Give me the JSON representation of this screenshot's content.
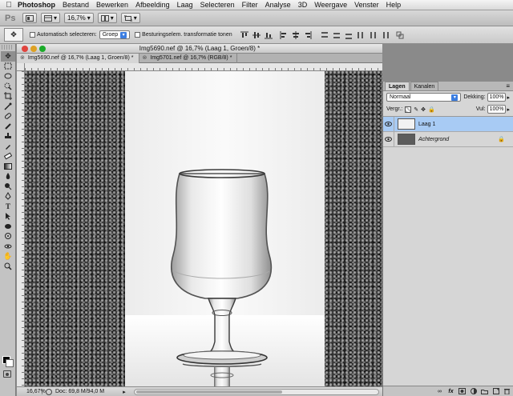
{
  "menubar": {
    "app": "Photoshop",
    "items": [
      "Bestand",
      "Bewerken",
      "Afbeelding",
      "Laag",
      "Selecteren",
      "Filter",
      "Analyse",
      "3D",
      "Weergave",
      "Venster",
      "Help"
    ]
  },
  "appbar": {
    "logo": "Ps",
    "zoom": "16,7%"
  },
  "options": {
    "auto_select_label": "Automatisch selecteren:",
    "auto_select_value": "Groep",
    "transform_label": "Besturingselem. transformatie tonen"
  },
  "document": {
    "title": "Img5690.nef @ 16,7% (Laag 1, Groen/8) *",
    "tabs": [
      {
        "label": "Img5690.nef @ 16,7% (Laag 1, Groen/8) *"
      },
      {
        "label": "Img5701.nef @ 16,7% (RGB/8) *"
      }
    ],
    "status": {
      "zoom": "16,67%",
      "doc": "Doc: 69,8 M/94,0 M"
    }
  },
  "layers_panel": {
    "tabs": [
      "Lagen",
      "Kanalen"
    ],
    "blend_mode": "Normaal",
    "opacity_label": "Dekking:",
    "opacity_value": "100%",
    "lock_label": "Vergr.:",
    "fill_label": "Vul:",
    "fill_value": "100%",
    "layers": [
      {
        "name": "Laag 1",
        "selected": true
      },
      {
        "name": "Achtergrond",
        "selected": false
      }
    ]
  },
  "colors": {
    "selection": "#a8cbf4",
    "accent": "#3b7de0"
  }
}
